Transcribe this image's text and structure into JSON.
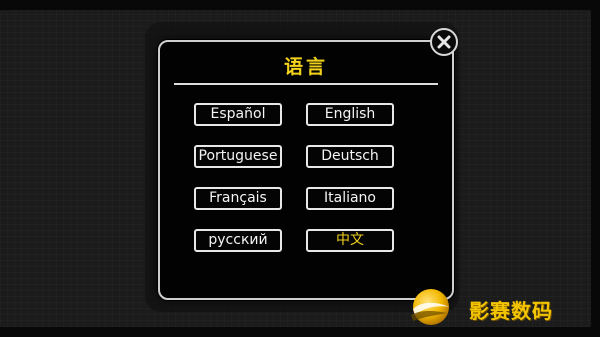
{
  "dialog": {
    "title": "语言",
    "languages": [
      {
        "label": "Español"
      },
      {
        "label": "English"
      },
      {
        "label": "Portuguese"
      },
      {
        "label": "Deutsch"
      },
      {
        "label": "Français"
      },
      {
        "label": "Italiano"
      },
      {
        "label": "русский"
      },
      {
        "label": "中文",
        "selected": true
      }
    ],
    "close_icon": "close-x-icon"
  },
  "watermark": {
    "text": "影赛数码",
    "icon": "orb-logo"
  },
  "colors": {
    "accent": "#f2d21b",
    "background": "#020202",
    "border": "#e8e8e8",
    "watermark": "#f3c400"
  }
}
